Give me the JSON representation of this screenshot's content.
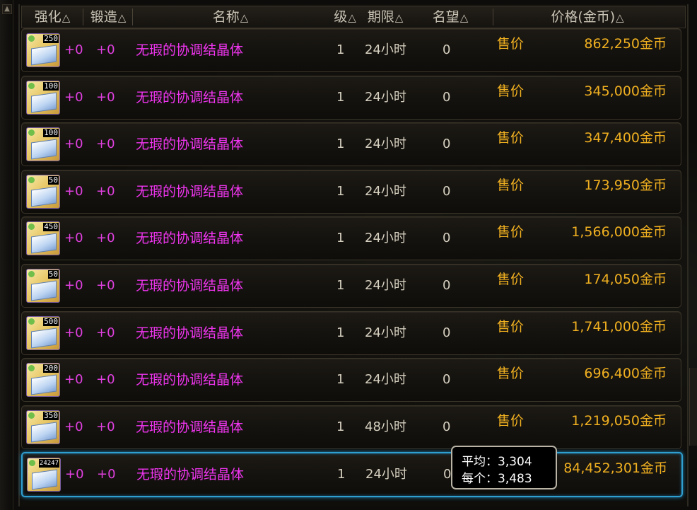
{
  "header": {
    "col_enhance": "强化",
    "col_forge": "锻造",
    "col_name": "名称",
    "col_level": "级",
    "col_expiry": "期限",
    "col_fame": "名望",
    "col_price": "价格(金币)",
    "sort_glyph": "△"
  },
  "rows": [
    {
      "qty": "250",
      "enhance": "+0",
      "forge": "+0",
      "name": "无瑕的协调结晶体",
      "level": "1",
      "expiry": "24小时",
      "fame": "0",
      "sell_label": "售价",
      "price": "862,250金币"
    },
    {
      "qty": "100",
      "enhance": "+0",
      "forge": "+0",
      "name": "无瑕的协调结晶体",
      "level": "1",
      "expiry": "24小时",
      "fame": "0",
      "sell_label": "售价",
      "price": "345,000金币"
    },
    {
      "qty": "100",
      "enhance": "+0",
      "forge": "+0",
      "name": "无瑕的协调结晶体",
      "level": "1",
      "expiry": "24小时",
      "fame": "0",
      "sell_label": "售价",
      "price": "347,400金币"
    },
    {
      "qty": "50",
      "enhance": "+0",
      "forge": "+0",
      "name": "无瑕的协调结晶体",
      "level": "1",
      "expiry": "24小时",
      "fame": "0",
      "sell_label": "售价",
      "price": "173,950金币"
    },
    {
      "qty": "450",
      "enhance": "+0",
      "forge": "+0",
      "name": "无瑕的协调结晶体",
      "level": "1",
      "expiry": "24小时",
      "fame": "0",
      "sell_label": "售价",
      "price": "1,566,000金币"
    },
    {
      "qty": "50",
      "enhance": "+0",
      "forge": "+0",
      "name": "无瑕的协调结晶体",
      "level": "1",
      "expiry": "24小时",
      "fame": "0",
      "sell_label": "售价",
      "price": "174,050金币"
    },
    {
      "qty": "500",
      "enhance": "+0",
      "forge": "+0",
      "name": "无瑕的协调结晶体",
      "level": "1",
      "expiry": "24小时",
      "fame": "0",
      "sell_label": "售价",
      "price": "1,741,000金币"
    },
    {
      "qty": "200",
      "enhance": "+0",
      "forge": "+0",
      "name": "无瑕的协调结晶体",
      "level": "1",
      "expiry": "24小时",
      "fame": "0",
      "sell_label": "售价",
      "price": "696,400金币"
    },
    {
      "qty": "350",
      "enhance": "+0",
      "forge": "+0",
      "name": "无瑕的协调结晶体",
      "level": "1",
      "expiry": "48小时",
      "fame": "0",
      "sell_label": "售价",
      "price": "1,219,050金币"
    },
    {
      "qty": "24247",
      "enhance": "+0",
      "forge": "+0",
      "name": "无瑕的协调结晶体",
      "level": "1",
      "expiry": "24小时",
      "fame": "0",
      "sell_label": "",
      "price": "84,452,301金币"
    }
  ],
  "tooltip": {
    "avg_label": "平均",
    "avg_value": "3,304",
    "each_label": "每个",
    "each_value": "3,483",
    "sep": "："
  },
  "colors": {
    "name": "#f035f0",
    "enhance": "#e040e0",
    "price": "#f0b020",
    "selected_border": "#2f9fd0"
  },
  "icons": {
    "item": "crystal-book-icon"
  }
}
